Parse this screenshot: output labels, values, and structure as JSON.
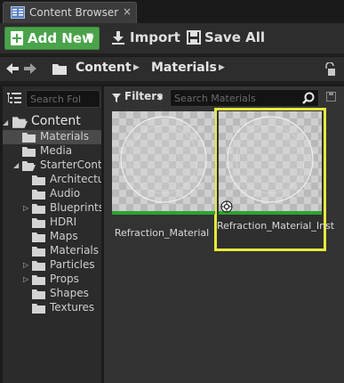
{
  "tab": {
    "title": "Content Browser",
    "close": "×"
  },
  "toolbar": {
    "add_new": "Add New",
    "import": "Import",
    "save_all": "Save All"
  },
  "path": {
    "crumbs": [
      "Content",
      "Materials"
    ]
  },
  "sources": {
    "search_placeholder": "Search Fol",
    "tree": [
      {
        "label": "Content",
        "depth": 0,
        "expanded": true
      },
      {
        "label": "Materials",
        "depth": 1,
        "selected": true
      },
      {
        "label": "Media",
        "depth": 1
      },
      {
        "label": "StarterContent",
        "depth": 1,
        "expanded": true
      },
      {
        "label": "Architecture",
        "depth": 2
      },
      {
        "label": "Audio",
        "depth": 2
      },
      {
        "label": "Blueprints",
        "depth": 2,
        "collapsed": true
      },
      {
        "label": "HDRI",
        "depth": 2
      },
      {
        "label": "Maps",
        "depth": 2
      },
      {
        "label": "Materials",
        "depth": 2
      },
      {
        "label": "Particles",
        "depth": 2,
        "collapsed": true
      },
      {
        "label": "Props",
        "depth": 2,
        "collapsed": true
      },
      {
        "label": "Shapes",
        "depth": 2
      },
      {
        "label": "Textures",
        "depth": 2
      }
    ]
  },
  "assets": {
    "filters_label": "Filters",
    "search_placeholder": "Search Materials",
    "items": [
      {
        "name": "Refraction_Material",
        "selected": false
      },
      {
        "name": "Refraction_Material_Inst",
        "selected": true
      }
    ]
  },
  "colors": {
    "add_new_bg": "#4aa34a",
    "selection_outline": "#e8e83c",
    "asset_type_bar": "#2fa32f"
  },
  "icons": {
    "tab": "content-browser-icon",
    "add_new": "document-plus-icon",
    "import": "download-icon",
    "save_all": "floppy-disk-icon",
    "back": "arrow-left-icon",
    "forward": "arrow-right-icon",
    "folder": "folder-icon",
    "lock": "lock-icon",
    "tree_toggle": "sources-panel-toggle-icon",
    "filter": "funnel-icon",
    "search": "magnifier-icon",
    "instance": "material-instance-icon"
  }
}
